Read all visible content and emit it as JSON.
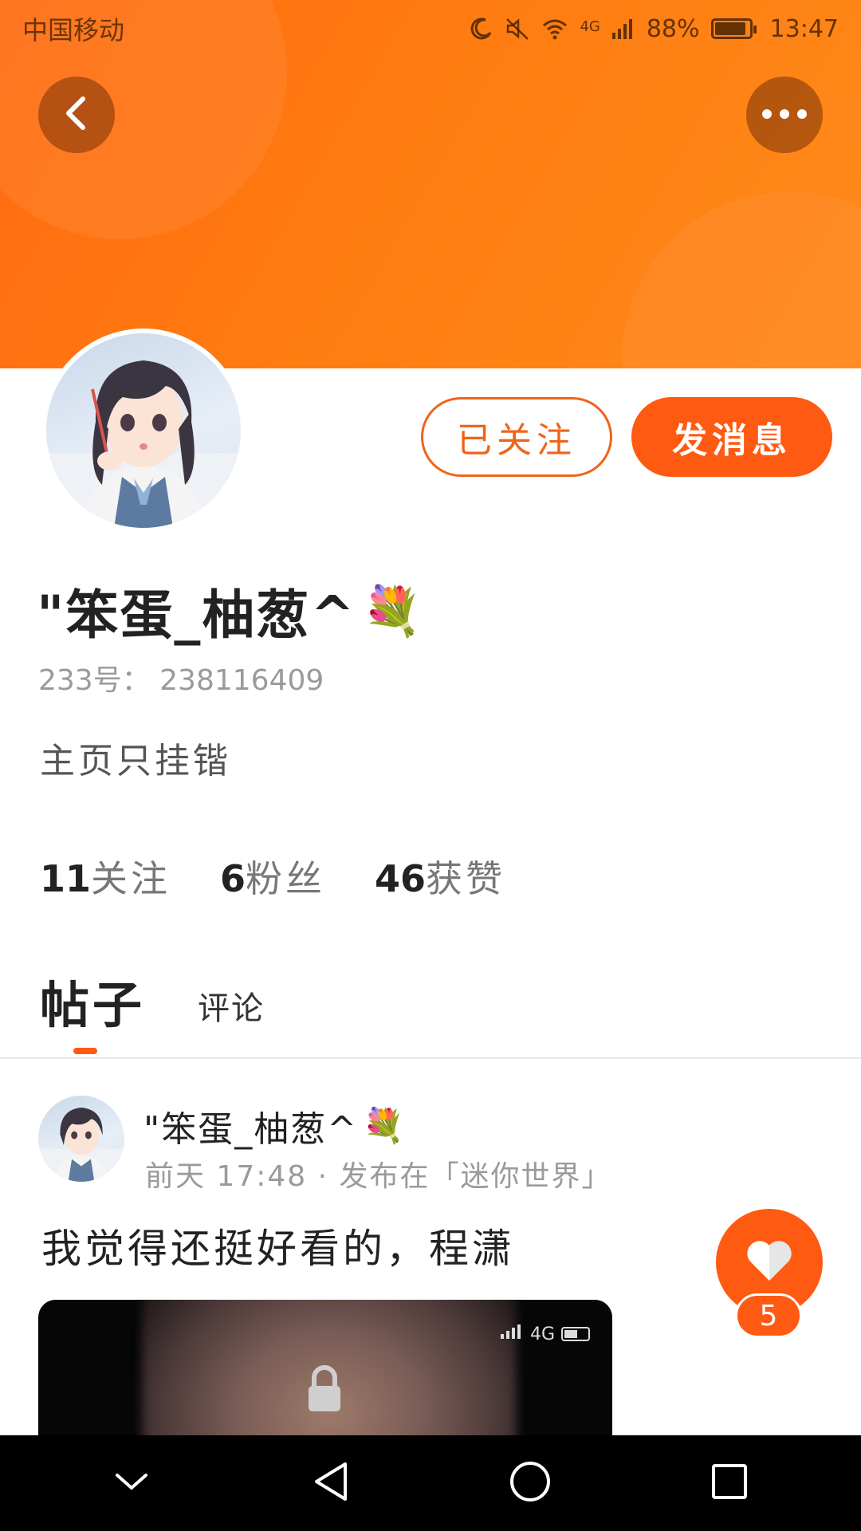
{
  "status_bar": {
    "carrier": "中国移动",
    "network": "4G",
    "battery": "88%",
    "time": "13:47"
  },
  "colors": {
    "accent": "#ff5a12",
    "banner": "#ff7a10",
    "text_primary": "#222222",
    "text_secondary": "#9a9a9a"
  },
  "header": {
    "back_icon": "chevron-left-icon",
    "more_icon": "more-horizontal-icon"
  },
  "profile": {
    "username": "\"笨蛋_柚葱^",
    "username_emoji": "💐",
    "uid": "233号： 238116409",
    "bio": "主页只挂锴",
    "follow_button": "已关注",
    "message_button": "发消息",
    "stats": {
      "following_count": "11",
      "following_label": "关注",
      "fans_count": "6",
      "fans_label": "粉丝",
      "likes_count": "46",
      "likes_label": "获赞"
    }
  },
  "tabs": {
    "posts": "帖子",
    "comments": "评论"
  },
  "post": {
    "author": "\"笨蛋_柚葱^",
    "author_emoji": "💐",
    "meta": "前天 17:48 · 发布在「迷你世界」",
    "text": "我觉得还挺好看的，程潇",
    "image_status": "4G",
    "like_count": "5"
  },
  "navbar": {
    "items": [
      "collapse-icon",
      "back-triangle-icon",
      "home-circle-icon",
      "recents-square-icon"
    ]
  }
}
